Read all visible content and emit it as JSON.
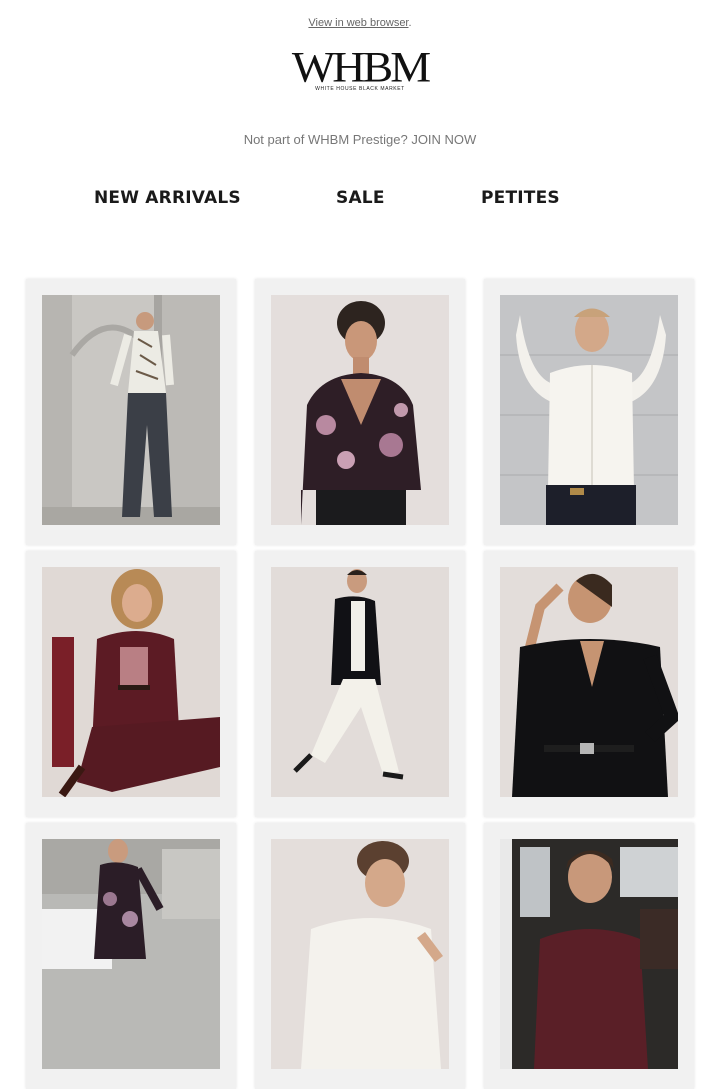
{
  "header": {
    "browser_link": "View in web browser",
    "browser_link_period": ".",
    "logo_text": "WHBM",
    "logo_subtext": "WHITE HOUSE BLACK MARKET",
    "join_prefix": "Not part of WHBM Prestige?",
    "join_link": "JOIN NOW"
  },
  "nav": {
    "items": [
      {
        "label": "NEW ARRIVALS"
      },
      {
        "label": "SALE"
      },
      {
        "label": "PETITES"
      }
    ]
  },
  "products": [
    {
      "subject": "model in printed blouse and dark wide-leg jeans by stone columns"
    },
    {
      "subject": "model in floral print sheer blouse"
    },
    {
      "subject": "model in white embroidered blouse"
    },
    {
      "subject": "model in burgundy suit seated"
    },
    {
      "subject": "model in black blazer and white wide-leg pants walking"
    },
    {
      "subject": "model in black blazer with belt"
    },
    {
      "subject": "model in floral dress by white car"
    },
    {
      "subject": "model in white top"
    },
    {
      "subject": "model in burgundy leather jacket in car"
    }
  ],
  "colors": {
    "text_dark": "#111111",
    "text_muted": "#777777",
    "card_bg": "#f1f1f1"
  }
}
